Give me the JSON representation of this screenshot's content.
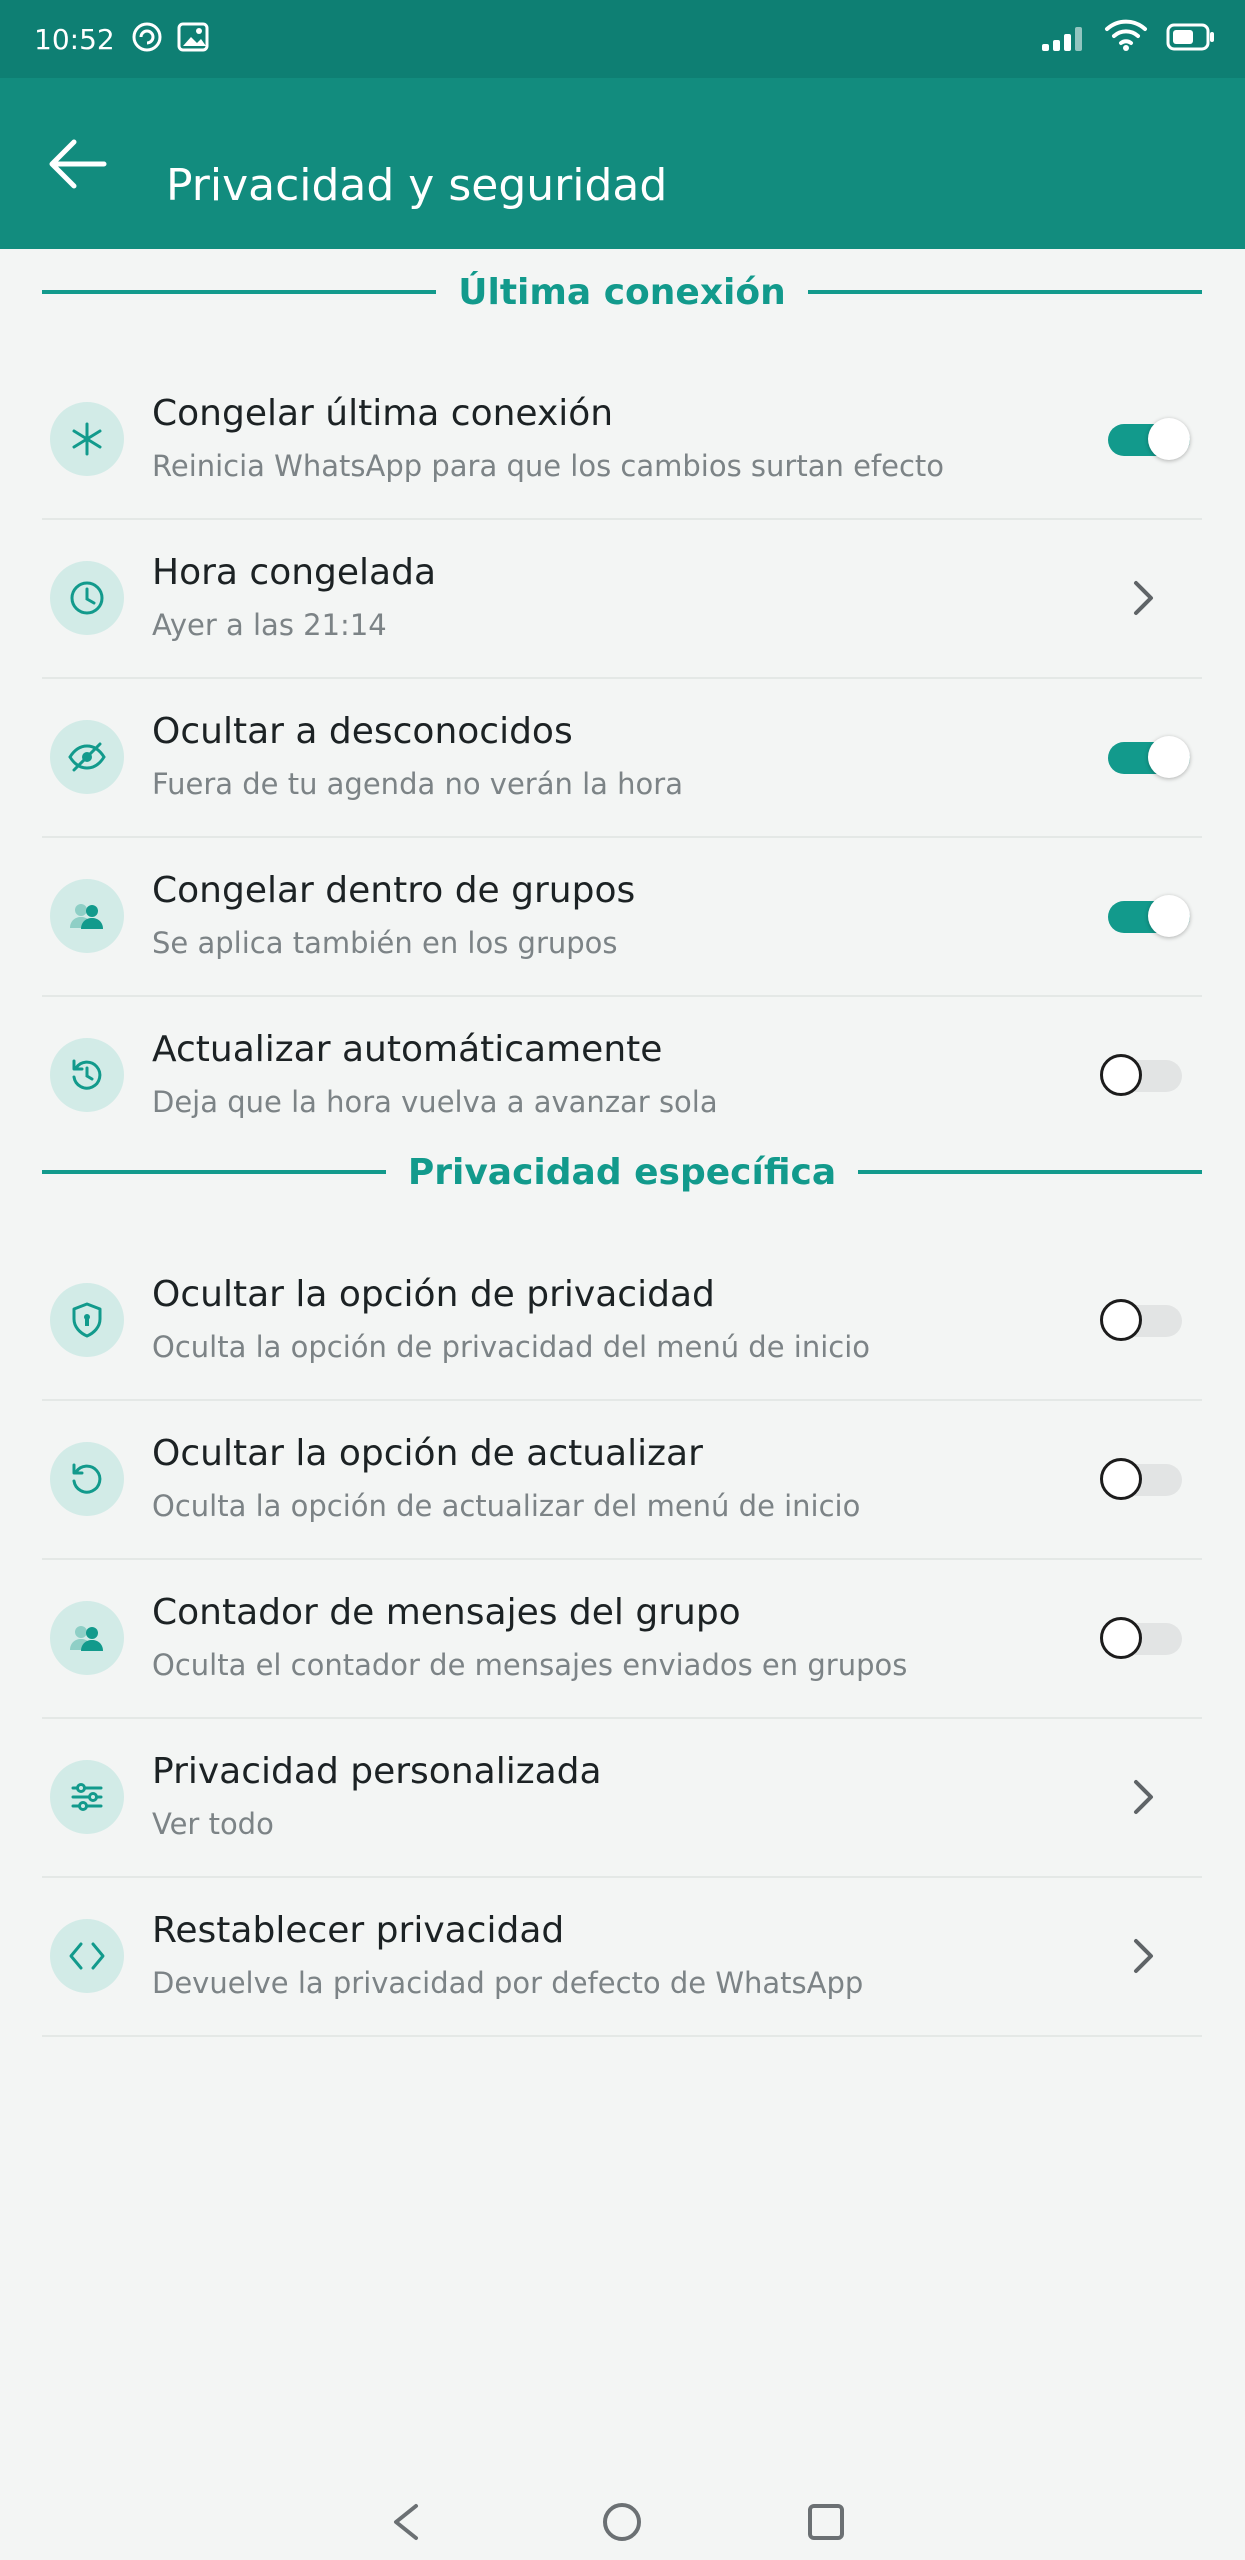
{
  "status_bar": {
    "time": "10:52",
    "icons": [
      "sync-icon",
      "image-icon",
      "signal-icon",
      "wifi-icon",
      "battery-icon"
    ]
  },
  "app_bar": {
    "title": "Privacidad y seguridad",
    "back_icon": "arrow-left-icon"
  },
  "sections": [
    {
      "header": "Última conexión",
      "items": [
        {
          "title": "Congelar última conexión",
          "subtitle": "Reinicia WhatsApp para que los cambios surtan efecto",
          "icon": "snowflake-icon",
          "control": "toggle",
          "state": "on"
        },
        {
          "title": "Hora congelada",
          "subtitle": "Ayer a las 21:14",
          "icon": "clock-icon",
          "control": "chevron"
        },
        {
          "title": "Ocultar a desconocidos",
          "subtitle": "Fuera de tu agenda no verán la hora",
          "icon": "eye-off-icon",
          "control": "toggle",
          "state": "on"
        },
        {
          "title": "Congelar dentro de grupos",
          "subtitle": "Se aplica también en los grupos",
          "icon": "group-icon",
          "control": "toggle",
          "state": "on"
        },
        {
          "title": "Actualizar automáticamente",
          "subtitle": "Deja que la hora vuelva a avanzar sola",
          "icon": "refresh-icon",
          "control": "toggle",
          "state": "off"
        }
      ]
    },
    {
      "header": "Privacidad específica",
      "items": [
        {
          "title": "Ocultar la opción de privacidad",
          "subtitle": "Oculta la opción de privacidad del menú de inicio",
          "icon": "shield-icon",
          "control": "toggle",
          "state": "off"
        },
        {
          "title": "Ocultar la opción de actualizar",
          "subtitle": "Oculta la opción de actualizar del menú de inicio",
          "icon": "refresh-icon",
          "control": "toggle",
          "state": "off"
        },
        {
          "title": "Contador de mensajes del grupo",
          "subtitle": "Oculta el contador de mensajes enviados en grupos",
          "icon": "group-icon",
          "control": "toggle",
          "state": "off"
        },
        {
          "title": "Privacidad personalizada",
          "subtitle": "Ver todo",
          "icon": "sliders-icon",
          "control": "chevron"
        },
        {
          "title": "Restablecer privacidad",
          "subtitle": "Devuelve la privacidad por defecto de WhatsApp",
          "icon": "code-icon",
          "control": "chevron"
        }
      ]
    }
  ],
  "nav_bar": {
    "buttons": [
      "back-triangle-icon",
      "home-circle-icon",
      "recents-square-icon"
    ]
  },
  "colors": {
    "status_bar": "#0e7f73",
    "app_bar": "#128c7e",
    "accent": "#129a8c",
    "background": "#f3f5f4",
    "icon_circle": "#d2ebe7"
  }
}
